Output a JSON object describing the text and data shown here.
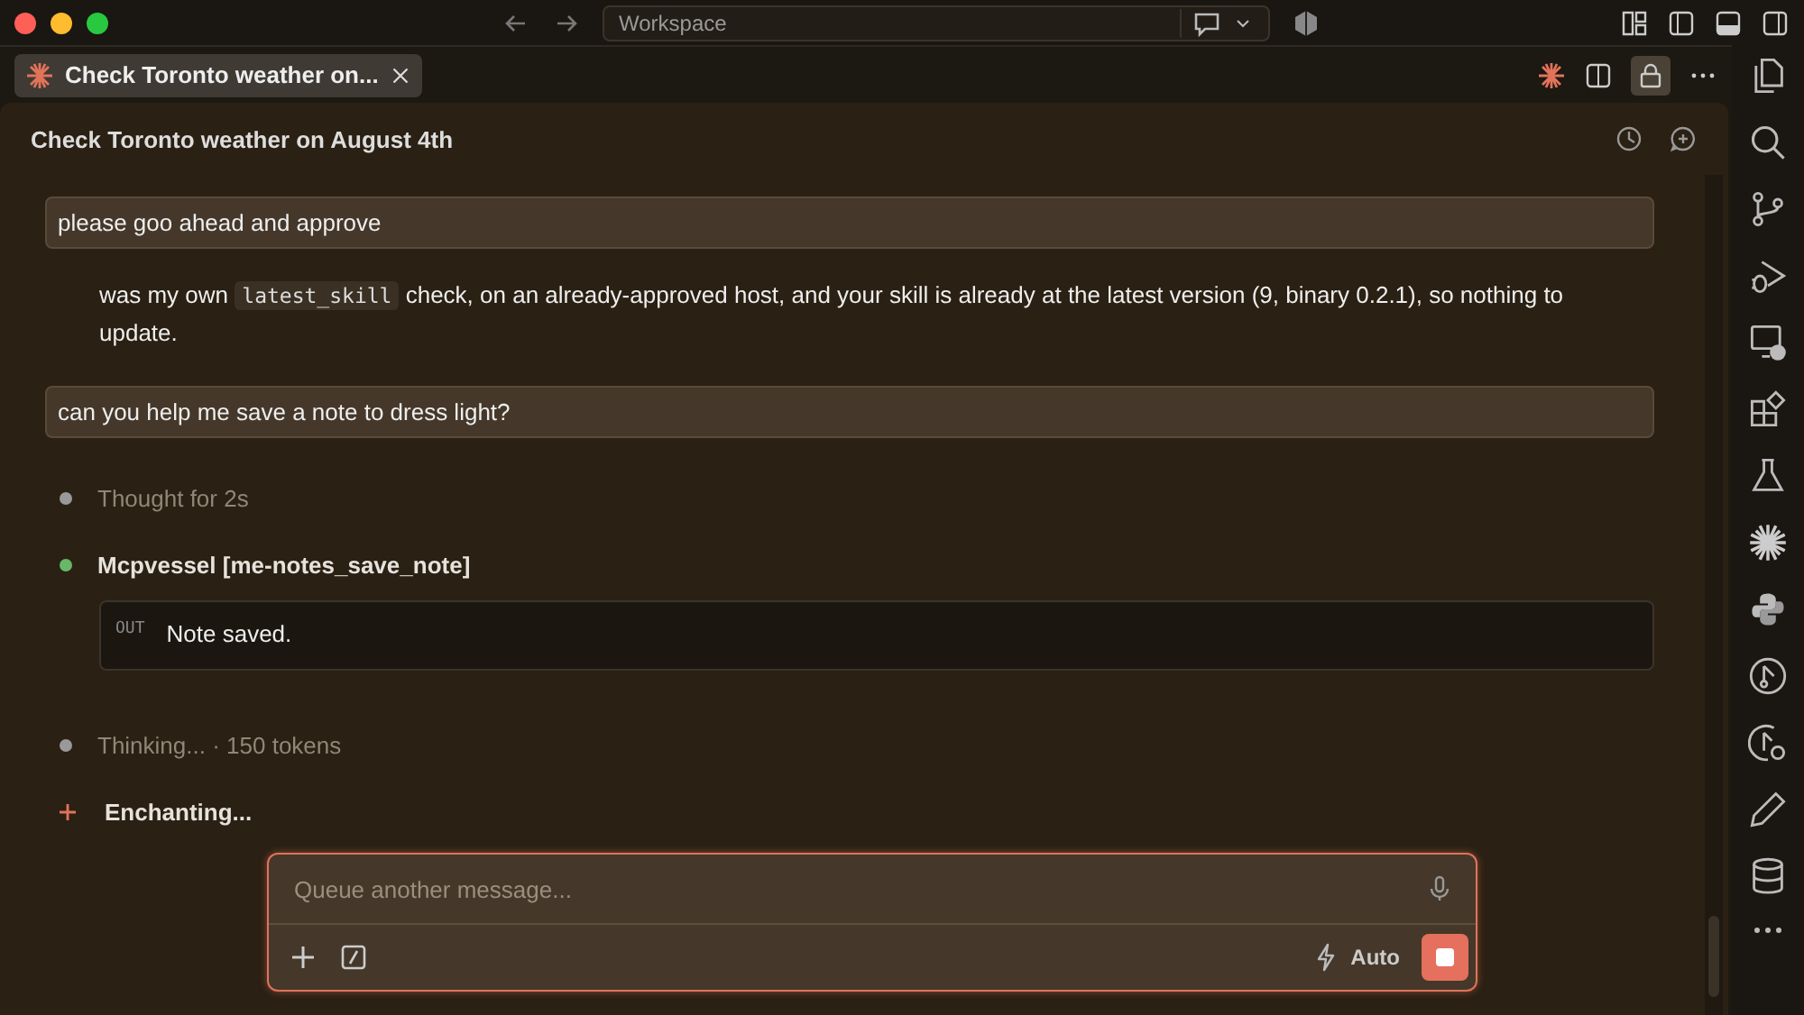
{
  "window": {
    "search_placeholder": "Workspace"
  },
  "tab": {
    "title": "Check Toronto weather on...",
    "selected": true
  },
  "chat": {
    "title": "Check Toronto weather on August 4th"
  },
  "messages": [
    {
      "kind": "user",
      "text": "please goo ahead and approve"
    },
    {
      "kind": "assistant",
      "segments": [
        {
          "kind": "text",
          "text": "was my own "
        },
        {
          "kind": "code",
          "text": "latest_skill"
        },
        {
          "kind": "text",
          "text": " check, on an already-approved host, and your skill is already at the latest version (9, binary 0.2.1), so nothing to update."
        }
      ]
    },
    {
      "kind": "user",
      "text": "can you help me save a note to dress light?"
    },
    {
      "kind": "thought",
      "text": "Thought for 2s"
    },
    {
      "kind": "tool",
      "text": "Mcpvessel [me-notes_save_note]",
      "output_label": "OUT",
      "output": "Note saved."
    },
    {
      "kind": "thought",
      "text": "Thinking... · 150 tokens"
    },
    {
      "kind": "working",
      "text": "Enchanting..."
    }
  ],
  "composer": {
    "placeholder": "Queue another message...",
    "mode": "Auto"
  }
}
